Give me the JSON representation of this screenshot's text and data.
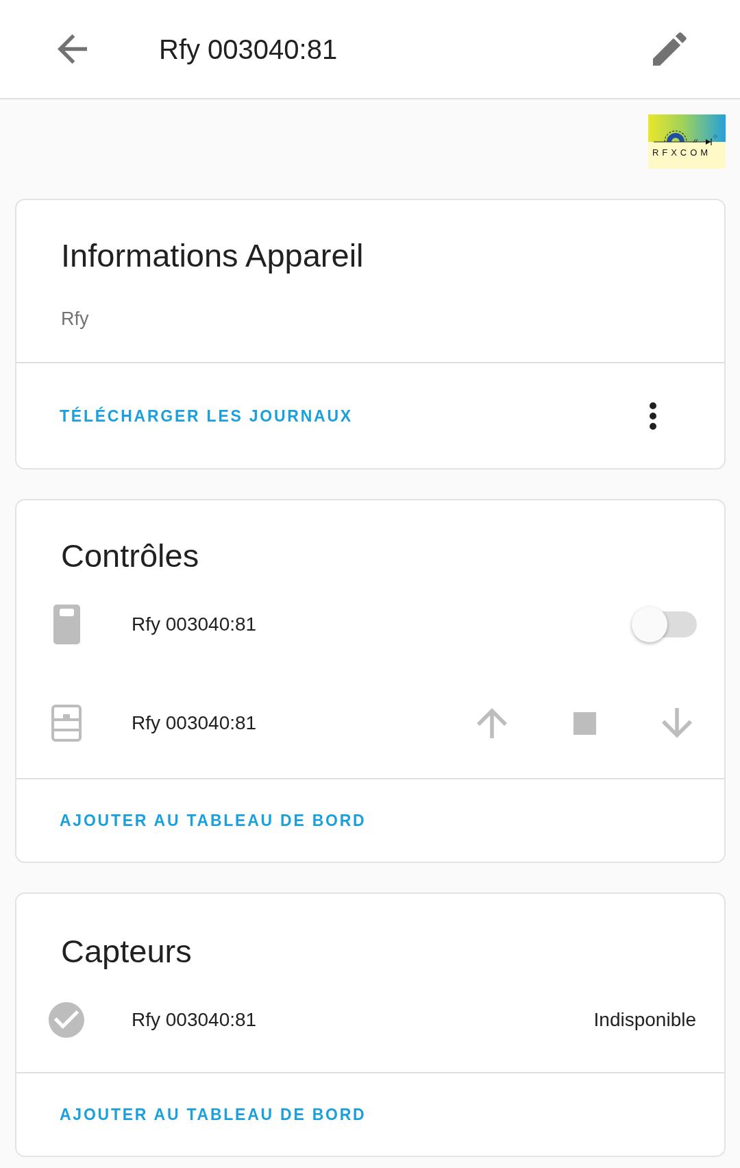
{
  "header": {
    "title": "Rfy 003040:81"
  },
  "logo": {
    "text": "RFXCOM"
  },
  "device_info": {
    "title": "Informations Appareil",
    "model": "Rfy",
    "action": "TÉLÉCHARGER LES JOURNAUX"
  },
  "controls": {
    "title": "Contrôles",
    "entities": [
      {
        "kind": "switch",
        "name": "Rfy 003040:81",
        "on": false
      },
      {
        "kind": "cover",
        "name": "Rfy 003040:81",
        "disabled": true
      }
    ],
    "action": "AJOUTER AU TABLEAU DE BORD"
  },
  "sensors": {
    "title": "Capteurs",
    "entities": [
      {
        "kind": "binary_sensor",
        "name": "Rfy 003040:81",
        "state": "Indisponible"
      }
    ],
    "action": "AJOUTER AU TABLEAU DE BORD"
  }
}
